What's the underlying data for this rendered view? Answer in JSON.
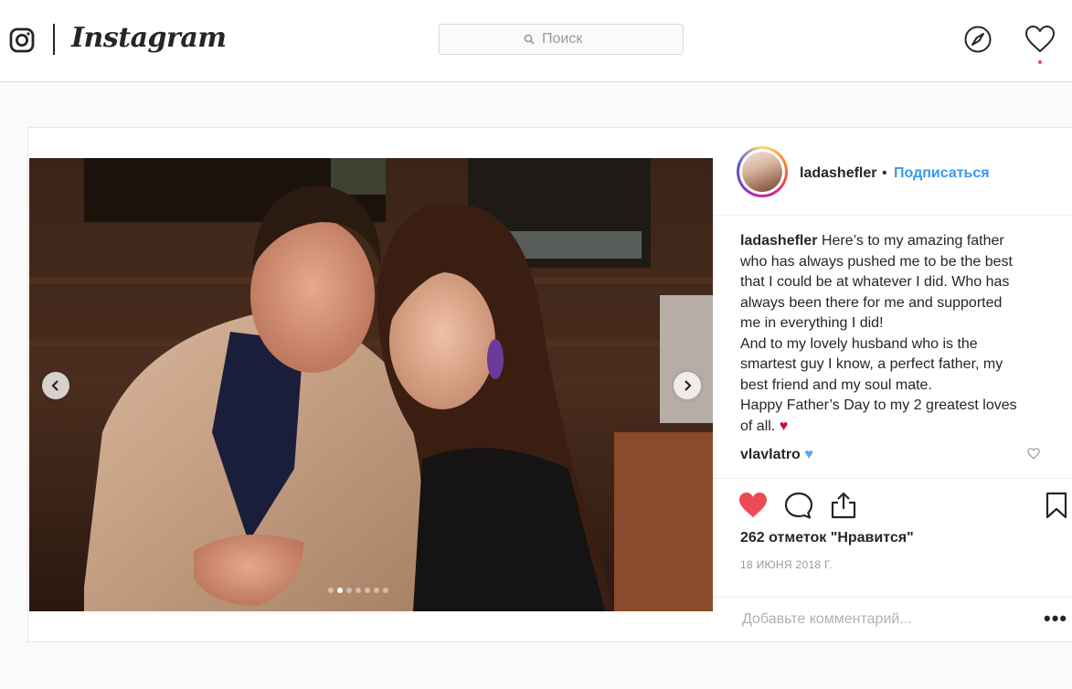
{
  "header": {
    "logo_text": "Instagram",
    "search_placeholder": "Поиск"
  },
  "post": {
    "username": "ladashefler",
    "separator": "•",
    "follow_label": "Подписаться",
    "caption_lines": [
      "Here’s to my amazing father",
      "who has always pushed me to be the best",
      "that I could be at whatever I did. Who has",
      "always been there for me and supported",
      "me in everything I did!",
      "And to my lovely husband who is the",
      "smartest guy I know, a perfect father, my",
      "best friend and my soul mate.",
      "Happy Father’s Day to my 2 greatest loves",
      "of all."
    ],
    "caption_heart": "♥",
    "comments": [
      {
        "user": "vlavlatro",
        "emoji": "♥"
      }
    ],
    "likes_text": "262 отметок \"Нравится\"",
    "date": "18 ИЮНЯ 2018 Г.",
    "comment_placeholder": "Добавьте комментарий...",
    "more_label": "•••",
    "carousel": {
      "slide_count": 7,
      "active_index": 1
    }
  },
  "colors": {
    "accent": "#3897f0",
    "like_red": "#ed4956",
    "text": "#262626",
    "muted": "#999999"
  }
}
